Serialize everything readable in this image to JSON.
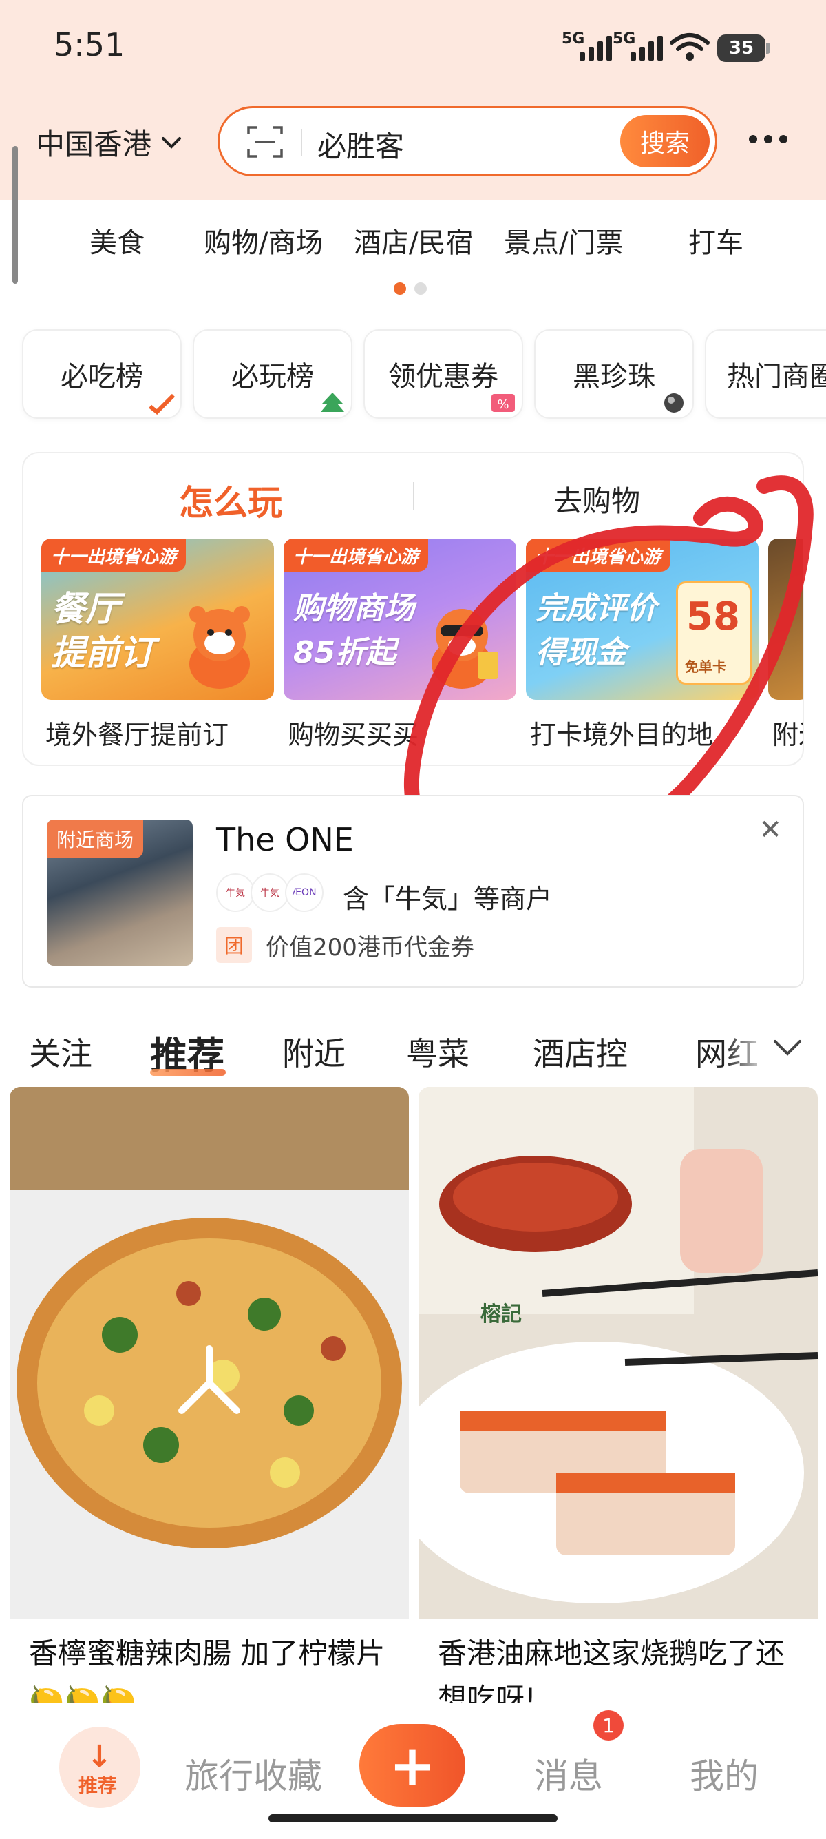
{
  "status_bar": {
    "time": "5:51",
    "signal1": "5G",
    "signal2": "5G",
    "battery": "35"
  },
  "header": {
    "location": "中国香港",
    "search_value": "必胜客",
    "search_button": "搜索"
  },
  "category_nav": {
    "items": [
      "美食",
      "购物/商场",
      "酒店/民宿",
      "景点/门票",
      "打车"
    ],
    "page_index": 0,
    "page_count": 2
  },
  "chips": [
    "必吃榜",
    "必玩榜",
    "领优惠券",
    "黑珍珠",
    "热门商圈"
  ],
  "play_card": {
    "tabs": [
      "怎么玩",
      "去购物"
    ],
    "promos": [
      {
        "tag": "十一出境省心游",
        "title": "餐厅\n提前订",
        "caption": "境外餐厅提前订"
      },
      {
        "tag": "十一出境省心游",
        "title": "购物商场\n85折起",
        "caption": "购物买买买"
      },
      {
        "tag": "十一出境省心游",
        "title": "完成评价\n得现金",
        "voucher_value": "58",
        "voucher_label": "免单卡",
        "caption": "打卡境外目的地"
      },
      {
        "caption": "附近"
      }
    ]
  },
  "mall_card": {
    "tag": "附近商场",
    "name": "The ONE",
    "logos": [
      "牛気",
      "牛気",
      "ÆON"
    ],
    "merchants": "含「牛気」等商户",
    "coupon_icon": "团",
    "coupon": "价值200港币代金券"
  },
  "feed_tabs": [
    "关注",
    "推荐",
    "附近",
    "粤菜",
    "酒店控",
    "网红"
  ],
  "feed_active_tab": "推荐",
  "feed": [
    {
      "title": "香檸蜜糖辣肉腸 加了柠檬片🍋🍋🍋"
    },
    {
      "title": "香港油麻地这家烧鹅吃了还想吃呀!",
      "image_label": "榕記"
    }
  ],
  "bottom_nav": {
    "home_label": "推荐",
    "favorites": "旅行收藏",
    "messages": "消息",
    "messages_badge": "1",
    "me": "我的"
  },
  "colors": {
    "accent": "#f0612a",
    "header_bg": "#fde8df",
    "annotation": "#e0272b"
  }
}
